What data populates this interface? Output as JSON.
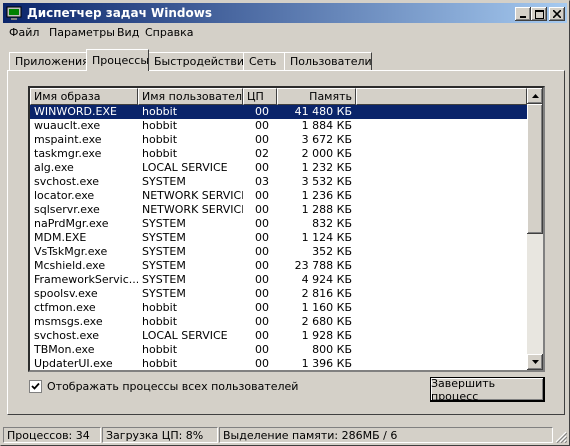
{
  "window": {
    "title": "Диспетчер задач Windows"
  },
  "titlebar_icons": [
    "minimize-icon",
    "maximize-icon",
    "close-icon"
  ],
  "menu": [
    "Файл",
    "Параметры",
    "Вид",
    "Справка"
  ],
  "tabs": [
    "Приложения",
    "Процессы",
    "Быстродействие",
    "Сеть",
    "Пользователи"
  ],
  "active_tab": "Процессы",
  "columns": [
    "Имя образа",
    "Имя пользователя",
    "ЦП",
    "Память"
  ],
  "rows": [
    {
      "image": "WINWORD.EXE",
      "user": "hobbit",
      "cpu": "00",
      "mem": "41 480 КБ",
      "selected": true
    },
    {
      "image": "wuauclt.exe",
      "user": "hobbit",
      "cpu": "00",
      "mem": "1 884 КБ"
    },
    {
      "image": "mspaint.exe",
      "user": "hobbit",
      "cpu": "00",
      "mem": "3 672 КБ"
    },
    {
      "image": "taskmgr.exe",
      "user": "hobbit",
      "cpu": "02",
      "mem": "2 000 КБ"
    },
    {
      "image": "alg.exe",
      "user": "LOCAL SERVICE",
      "cpu": "00",
      "mem": "1 232 КБ"
    },
    {
      "image": "svchost.exe",
      "user": "SYSTEM",
      "cpu": "03",
      "mem": "3 532 КБ"
    },
    {
      "image": "locator.exe",
      "user": "NETWORK SERVICE",
      "cpu": "00",
      "mem": "1 236 КБ"
    },
    {
      "image": "sqlservr.exe",
      "user": "NETWORK SERVICE",
      "cpu": "00",
      "mem": "1 288 КБ"
    },
    {
      "image": "naPrdMgr.exe",
      "user": "SYSTEM",
      "cpu": "00",
      "mem": "832 КБ"
    },
    {
      "image": "MDM.EXE",
      "user": "SYSTEM",
      "cpu": "00",
      "mem": "1 124 КБ"
    },
    {
      "image": "VsTskMgr.exe",
      "user": "SYSTEM",
      "cpu": "00",
      "mem": "352 КБ"
    },
    {
      "image": "Mcshield.exe",
      "user": "SYSTEM",
      "cpu": "00",
      "mem": "23 788 КБ"
    },
    {
      "image": "FrameworkServic...",
      "user": "SYSTEM",
      "cpu": "00",
      "mem": "4 924 КБ"
    },
    {
      "image": "spoolsv.exe",
      "user": "SYSTEM",
      "cpu": "00",
      "mem": "2 816 КБ"
    },
    {
      "image": "ctfmon.exe",
      "user": "hobbit",
      "cpu": "00",
      "mem": "1 160 КБ"
    },
    {
      "image": "msmsgs.exe",
      "user": "hobbit",
      "cpu": "00",
      "mem": "2 680 КБ"
    },
    {
      "image": "svchost.exe",
      "user": "LOCAL SERVICE",
      "cpu": "00",
      "mem": "1 928 КБ"
    },
    {
      "image": "TBMon.exe",
      "user": "hobbit",
      "cpu": "00",
      "mem": "800 КБ"
    },
    {
      "image": "UpdaterUI.exe",
      "user": "hobbit",
      "cpu": "00",
      "mem": "1 396 КБ"
    }
  ],
  "show_all_label": "Отображать процессы всех пользователей",
  "show_all_checked": true,
  "end_process_label": "Завершить процесс",
  "status": {
    "processes": "Процессов: 34",
    "cpu": "Загрузка ЦП: 8%",
    "memory": "Выделение памяти: 286МБ / 6"
  },
  "colors": {
    "title_start": "#0a246a",
    "title_end": "#a6caf0",
    "selection": "#0a246a",
    "face": "#d4d0c8"
  }
}
